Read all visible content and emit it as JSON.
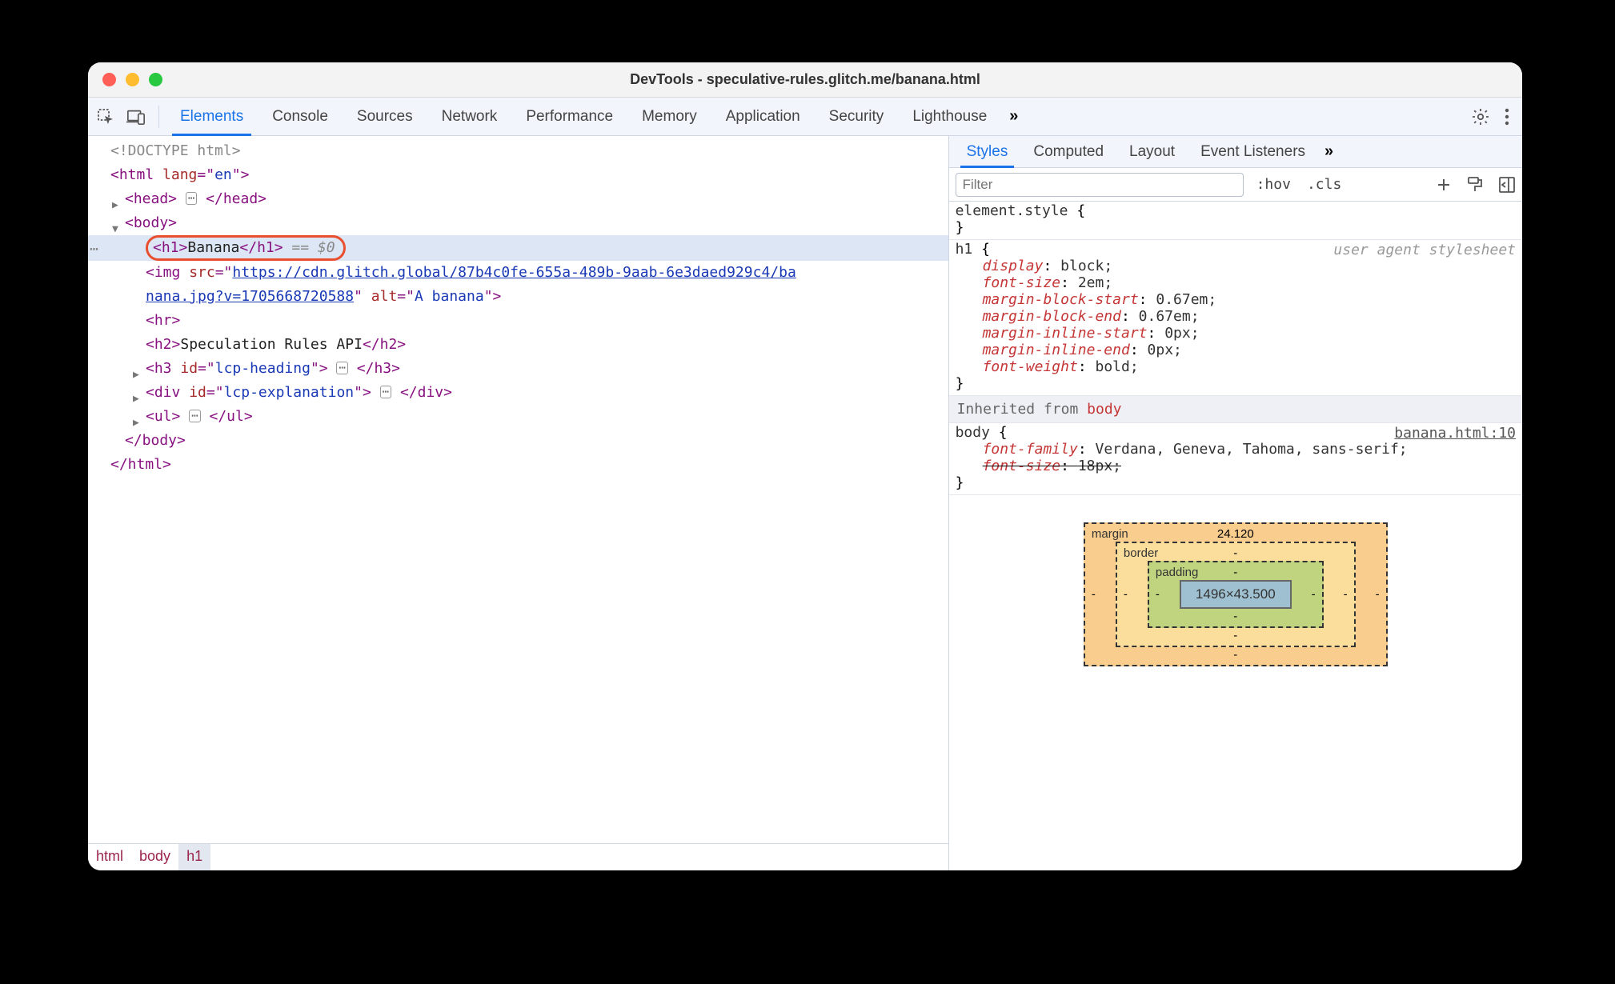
{
  "window": {
    "title": "DevTools - speculative-rules.glitch.me/banana.html"
  },
  "tabs": {
    "items": [
      "Elements",
      "Console",
      "Sources",
      "Network",
      "Performance",
      "Memory",
      "Application",
      "Security",
      "Lighthouse"
    ],
    "active_index": 0
  },
  "dom": {
    "doctype": "<!DOCTYPE html>",
    "html_open": "<html lang=\"en\">",
    "head": {
      "open": "<head>",
      "close": "</head>"
    },
    "body_open": "<body>",
    "selected": {
      "raw": "<h1>Banana</h1>",
      "suffix": " == $0"
    },
    "img": {
      "prefix": "<img src=\"",
      "url_line1": "https://cdn.glitch.global/87b4c0fe-655a-489b-9aab-6e3daed929c4/ba",
      "url_line2": "nana.jpg?v=1705668720588",
      "mid": "\" alt=\"",
      "alt": "A banana",
      "suffix": "\">"
    },
    "hr": "<hr>",
    "h2": {
      "open": "<h2>",
      "text": "Speculation Rules API",
      "close": "</h2>"
    },
    "h3": {
      "open": "<h3 id=\"lcp-heading\">",
      "close": "</h3>"
    },
    "div": {
      "open": "<div id=\"lcp-explanation\">",
      "close": "</div>"
    },
    "ul": {
      "open": "<ul>",
      "close": "</ul>"
    },
    "body_close": "</body>",
    "html_close": "</html>"
  },
  "breadcrumbs": [
    "html",
    "body",
    "h1"
  ],
  "styles": {
    "tabs": [
      "Styles",
      "Computed",
      "Layout",
      "Event Listeners"
    ],
    "active_index": 0,
    "filter_placeholder": "Filter",
    "toolbar": {
      "hov": ":hov",
      "cls": ".cls"
    },
    "element_style": {
      "selector": "element.style",
      "open": " {",
      "close": "}"
    },
    "h1_rule": {
      "selector": "h1",
      "open": " {",
      "note": "user agent stylesheet",
      "decls": [
        {
          "p": "display",
          "v": "block"
        },
        {
          "p": "font-size",
          "v": "2em"
        },
        {
          "p": "margin-block-start",
          "v": "0.67em"
        },
        {
          "p": "margin-block-end",
          "v": "0.67em"
        },
        {
          "p": "margin-inline-start",
          "v": "0px"
        },
        {
          "p": "margin-inline-end",
          "v": "0px"
        },
        {
          "p": "font-weight",
          "v": "bold"
        }
      ],
      "close": "}"
    },
    "inherited_label": "Inherited from ",
    "inherited_from": "body",
    "body_rule": {
      "selector": "body",
      "open": " {",
      "src": "banana.html:10",
      "decls": [
        {
          "p": "font-family",
          "v": "Verdana, Geneva, Tahoma, sans-serif",
          "strike": false
        },
        {
          "p": "font-size",
          "v": "18px",
          "strike": true
        }
      ],
      "close": "}"
    }
  },
  "box_model": {
    "margin": {
      "label": "margin",
      "top": "24.120",
      "right": "-",
      "bottom": "-",
      "left": "-"
    },
    "border": {
      "label": "border",
      "top": "-",
      "right": "-",
      "bottom": "-",
      "left": "-"
    },
    "padding": {
      "label": "padding",
      "top": "-",
      "right": "-",
      "bottom": "-",
      "left": "-"
    },
    "content": "1496×43.500"
  }
}
